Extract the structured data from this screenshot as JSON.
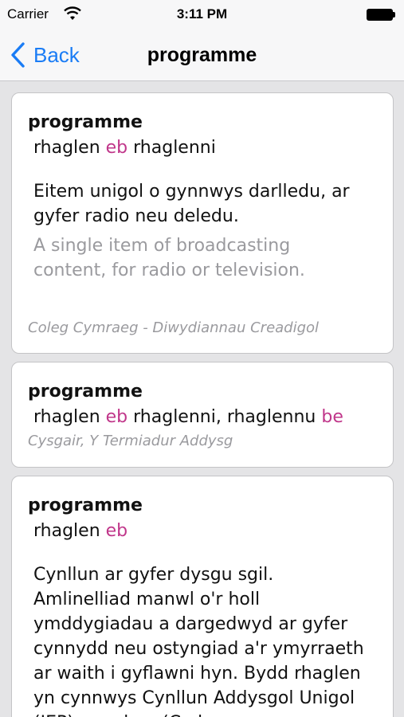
{
  "status_bar": {
    "carrier": "Carrier",
    "time": "3:11 PM"
  },
  "nav": {
    "back_label": "Back",
    "title": "programme"
  },
  "entries": [
    {
      "term": "programme",
      "line": {
        "w1": "rhaglen",
        "pos1": "eb",
        "w2": "rhaglenni"
      },
      "definition_cy": "Eitem unigol o gynnwys darlledu, ar gyfer radio neu deledu.",
      "definition_en": "A single item of broadcasting content, for radio or television.",
      "source": "Coleg Cymraeg - Diwydiannau Creadigol"
    },
    {
      "term": "programme",
      "line": {
        "w1": "rhaglen",
        "pos1": "eb",
        "w2": "rhaglenni, rhaglennu",
        "pos2": "be"
      },
      "source": "Cysgair, Y Termiadur Addysg"
    },
    {
      "term": "programme",
      "line": {
        "w1": "rhaglen",
        "pos1": "eb"
      },
      "definition_cy": "Cynllun ar gyfer dysgu sgil. Amlinelliad manwl o'r holl ymddygiadau a dargedwyd ar gyfer cynnydd neu ostyngiad a'r ymyrraeth ar waith i gyflawni hyn. Bydd rhaglen yn cynnwys Cynllun Addysgol Unigol (IEP), neu hyn (Cyd-"
    }
  ]
}
